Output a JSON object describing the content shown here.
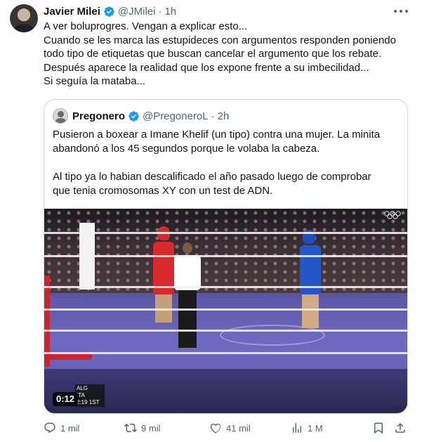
{
  "author": {
    "name": "Javier Milei",
    "handle": "@JMilei",
    "separator": "·",
    "time": "1h"
  },
  "tweet_lines": [
    "A ver boluprogres. Vengan a explicar esto...",
    "Cuando se les marca las estupideces con argumentos responden poniendo",
    "todo tipo de etiquetas que buscan cancelar el argumento que los rebate.",
    "Después aparece la realidad que los expone frente a su imbecilidad...",
    "Si seguía la mataba..."
  ],
  "quote": {
    "name": "Pregonero",
    "handle": "@PregoneroL",
    "separator": "·",
    "time": "2h",
    "lines": [
      "Pusieron a boxear a Imane Khelif (un tipo) contra una mujer.  La minita",
      "abandonó a los 45 segundos porque le volaba la cabeza.",
      "",
      "Al tipo ya lo habian descalificado el año pasado luego de comprobar",
      "que tenia cromosomas XY con un test de ADN."
    ],
    "video": {
      "time": "0:12",
      "scorebug": [
        "ALG",
        "ITA",
        "2:19 1ST"
      ]
    }
  },
  "actions": {
    "replies": "1 mil",
    "reposts": "9 mil",
    "likes": "41 mil",
    "views": "1 M"
  },
  "colors": {
    "verified": "#1d9bf0",
    "muted": "#536471",
    "border": "#cfd9de"
  },
  "icons": [
    "verified-badge-icon",
    "more-icon",
    "reply-icon",
    "repost-icon",
    "like-icon",
    "views-icon",
    "bookmark-icon",
    "share-icon"
  ]
}
